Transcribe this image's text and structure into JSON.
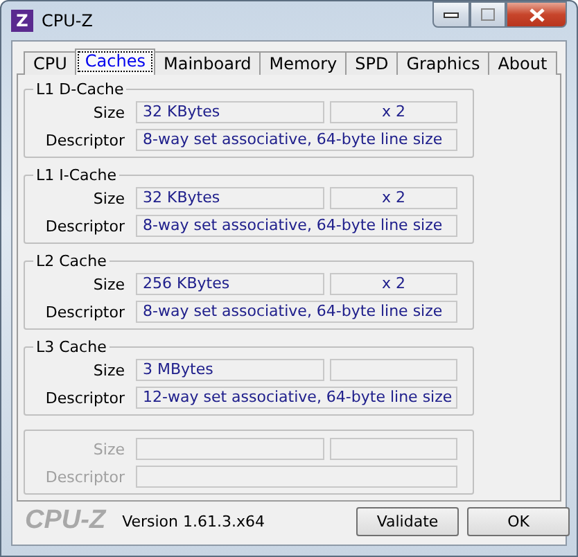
{
  "window": {
    "title": "CPU-Z",
    "icon": "Z"
  },
  "tabs": [
    {
      "label": "CPU",
      "selected": false
    },
    {
      "label": "Caches",
      "selected": true
    },
    {
      "label": "Mainboard",
      "selected": false
    },
    {
      "label": "Memory",
      "selected": false
    },
    {
      "label": "SPD",
      "selected": false
    },
    {
      "label": "Graphics",
      "selected": false
    },
    {
      "label": "About",
      "selected": false
    }
  ],
  "groups": [
    {
      "title": "L1 D-Cache",
      "disabled": false,
      "size_label": "Size",
      "size": "32 KBytes",
      "count": "x 2",
      "descriptor_label": "Descriptor",
      "descriptor": "8-way set associative, 64-byte line size"
    },
    {
      "title": "L1 I-Cache",
      "disabled": false,
      "size_label": "Size",
      "size": "32 KBytes",
      "count": "x 2",
      "descriptor_label": "Descriptor",
      "descriptor": "8-way set associative, 64-byte line size"
    },
    {
      "title": "L2 Cache",
      "disabled": false,
      "size_label": "Size",
      "size": "256 KBytes",
      "count": "x 2",
      "descriptor_label": "Descriptor",
      "descriptor": "8-way set associative, 64-byte line size"
    },
    {
      "title": "L3 Cache",
      "disabled": false,
      "size_label": "Size",
      "size": "3 MBytes",
      "descriptor_label": "Descriptor",
      "descriptor": "12-way set associative, 64-byte line size"
    },
    {
      "disabled": true,
      "size_label": "Size",
      "descriptor_label": "Descriptor"
    }
  ],
  "footer": {
    "logo": "CPU-Z",
    "version": "Version 1.61.3.x64",
    "buttons": [
      "Validate",
      "OK"
    ]
  }
}
